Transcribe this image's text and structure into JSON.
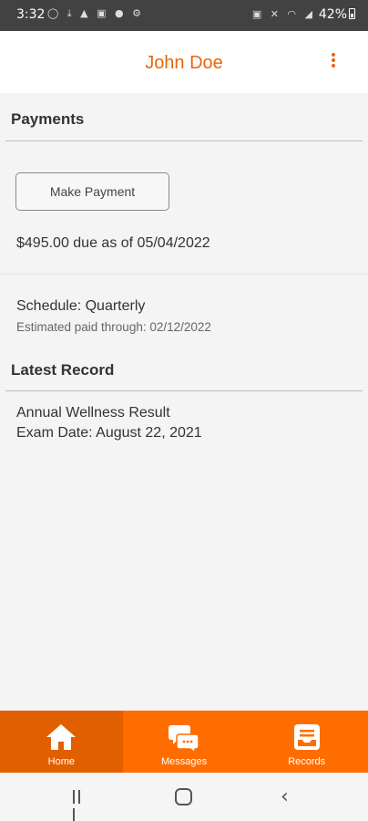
{
  "status_bar": {
    "time": "3:32",
    "notification_icons": "◯ ⤓ ▲ ▣ ● ⚙",
    "system_icons": "▣ ✕ ◠ ◢",
    "battery": "42%"
  },
  "header": {
    "title": "John Doe",
    "menu_icon": "more-vert-icon"
  },
  "payments": {
    "section_title": "Payments",
    "make_payment_label": "Make Payment",
    "amount_due": "$495.00 due as of 05/04/2022",
    "schedule": "Schedule: Quarterly",
    "paid_through": "Estimated paid through: 02/12/2022"
  },
  "latest_record": {
    "section_title": "Latest Record",
    "record_title": "Annual Wellness Result",
    "exam_date": "Exam Date: August 22, 2021"
  },
  "bottom_nav": {
    "items": [
      {
        "label": "Home",
        "icon": "home-icon",
        "active": true
      },
      {
        "label": "Messages",
        "icon": "messages-icon",
        "active": false
      },
      {
        "label": "Records",
        "icon": "records-icon",
        "active": false
      }
    ]
  },
  "colors": {
    "accent": "#e8650a",
    "nav_bar": "#ff6d00",
    "nav_active": "#e25f00"
  }
}
